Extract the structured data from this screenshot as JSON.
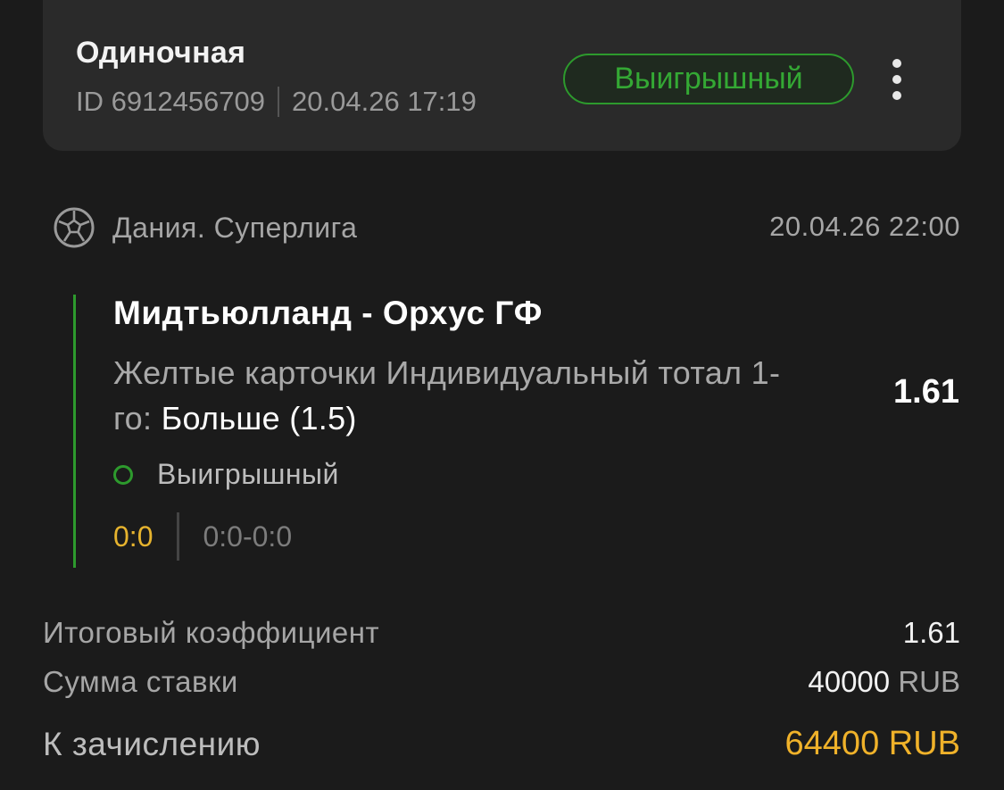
{
  "header": {
    "bet_type": "Одиночная",
    "bet_id": "ID 6912456709",
    "placed_at": "20.04.26 17:19",
    "status": "Выигрышный",
    "status_color": "#34a834"
  },
  "event": {
    "sport_icon": "soccer-ball-icon",
    "league": "Дания. Суперлига",
    "start_time": "20.04.26 22:00",
    "teams": "Мидтьюлланд - Орхус ГФ",
    "market": "Желтые карточки Индивидуальный тотал 1-го:",
    "selection": "Больше (1.5)",
    "odds": "1.61",
    "outcome": "Выигрышный",
    "score": "0:0",
    "score_detail": "0:0-0:0"
  },
  "summary": {
    "total_odds_label": "Итоговый коэффициент",
    "total_odds_value": "1.61",
    "stake_label": "Сумма ставки",
    "stake_amount": "40000",
    "stake_currency": "RUB",
    "payout_label": "К зачислению",
    "payout_value": "64400 RUB",
    "payout_color": "#f0b22a"
  }
}
